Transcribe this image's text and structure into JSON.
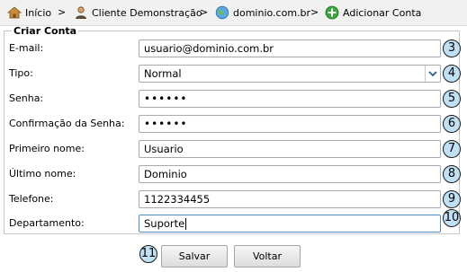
{
  "breadcrumb": {
    "items": [
      {
        "label": "Início",
        "icon": "home-icon"
      },
      {
        "label": "Cliente Demonstração",
        "icon": "user-icon"
      },
      {
        "label": "dominio.com.br",
        "icon": "globe-icon"
      },
      {
        "label": "Adicionar Conta",
        "icon": "add-icon"
      }
    ],
    "separator": ">"
  },
  "form": {
    "legend": "Criar Conta",
    "fields": [
      {
        "label": "E-mail:",
        "value": "usuario@dominio.com.br",
        "marker": "3"
      },
      {
        "label": "Tipo:",
        "value": "Normal",
        "marker": "4"
      },
      {
        "label": "Senha:",
        "value": "••••••",
        "marker": "5"
      },
      {
        "label": "Confirmação da Senha:",
        "value": "••••••",
        "marker": "6"
      },
      {
        "label": "Primeiro nome:",
        "value": "Usuario",
        "marker": "7"
      },
      {
        "label": "Último nome:",
        "value": "Dominio",
        "marker": "8"
      },
      {
        "label": "Telefone:",
        "value": "1122334455",
        "marker": "9"
      },
      {
        "label": "Departamento:",
        "value": "Suporte",
        "marker": "10"
      }
    ]
  },
  "actions": {
    "marker": "11",
    "save_label": "Salvar",
    "back_label": "Voltar"
  },
  "colors": {
    "marker_fill": "#bfe0f5",
    "add_icon": "#3aa83a",
    "focus_border": "#4d8fcc"
  }
}
